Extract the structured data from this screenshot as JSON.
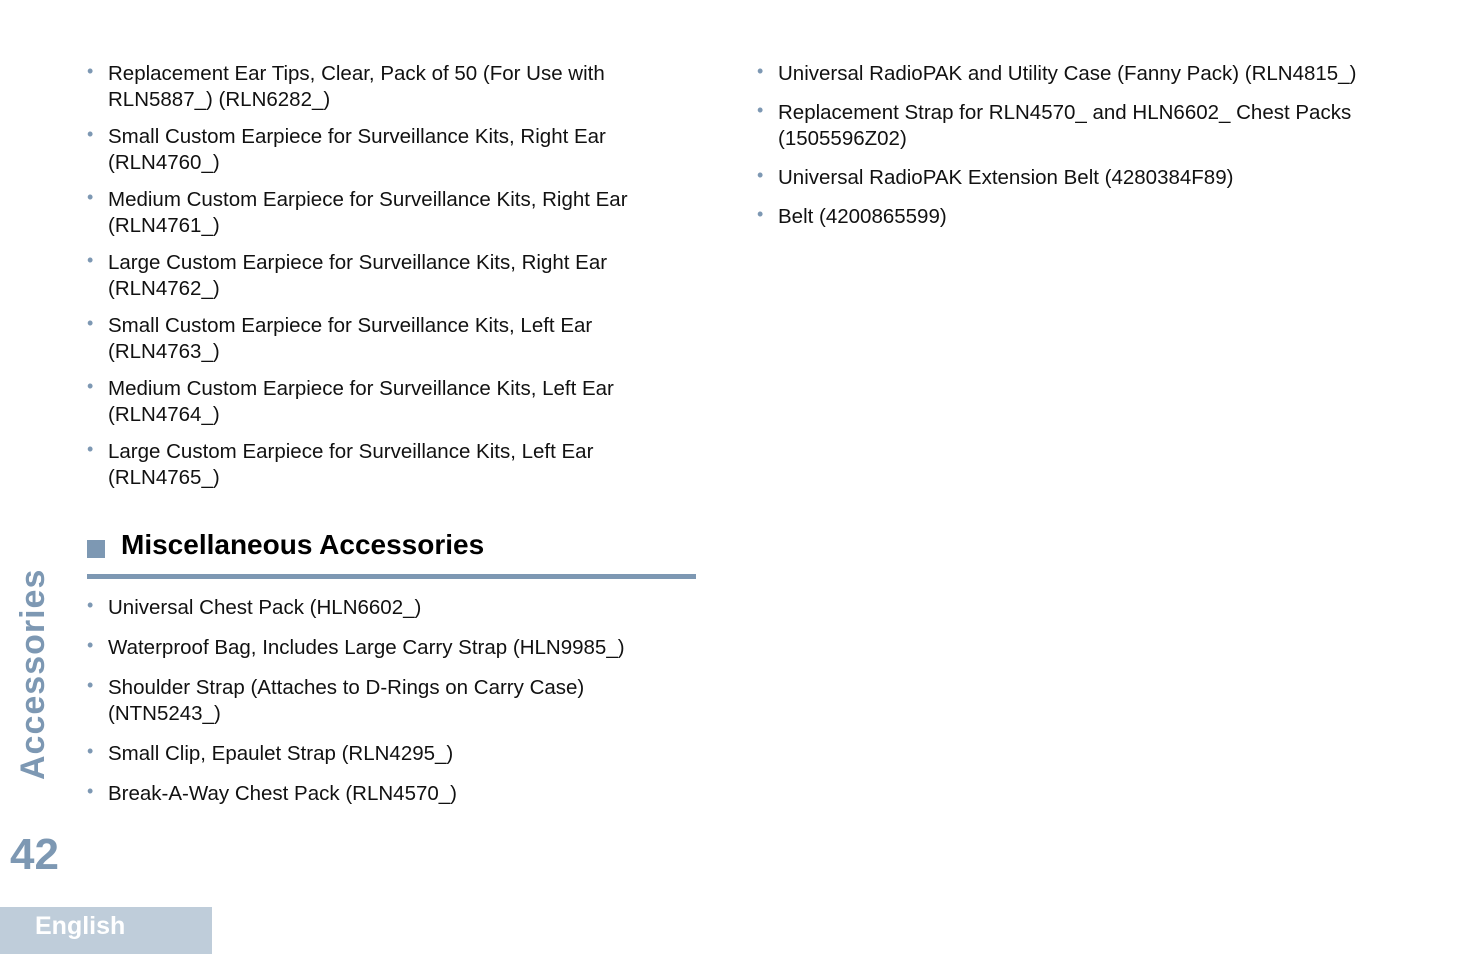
{
  "left_column": {
    "items": [
      "Replacement Ear Tips, Clear, Pack of 50 (For Use with RLN5887_) (RLN6282_)",
      "Small Custom Earpiece for Surveillance Kits, Right Ear (RLN4760_)",
      "Medium Custom Earpiece for Surveillance Kits, Right Ear (RLN4761_)",
      "Large Custom Earpiece for Surveillance Kits, Right Ear (RLN4762_)",
      "Small Custom Earpiece for Surveillance Kits, Left Ear (RLN4763_)",
      "Medium Custom Earpiece for Surveillance Kits, Left Ear (RLN4764_)",
      "Large Custom Earpiece for Surveillance Kits, Left Ear (RLN4765_)"
    ]
  },
  "misc_section": {
    "heading": "Miscellaneous Accessories",
    "items": [
      "Universal Chest Pack (HLN6602_)",
      "Waterproof Bag, Includes Large Carry Strap (HLN9985_)",
      "Shoulder Strap (Attaches to D-Rings on Carry Case) (NTN5243_)",
      "Small Clip, Epaulet Strap (RLN4295_)",
      "Break-A-Way Chest Pack (RLN4570_)"
    ]
  },
  "right_column": {
    "items": [
      "Universal RadioPAK and Utility Case (Fanny Pack) (RLN4815_)",
      "Replacement Strap for RLN4570_ and HLN6602_ Chest Packs (1505596Z02)",
      "Universal RadioPAK Extension Belt (4280384F89)",
      "Belt (4200865599)"
    ]
  },
  "side_tab": "Accessories",
  "page_number": "42",
  "language_tab": "English",
  "bullet_char": "•",
  "colors": {
    "accent": "#7d98b3",
    "language_tab_bg": "#bfcdda"
  }
}
